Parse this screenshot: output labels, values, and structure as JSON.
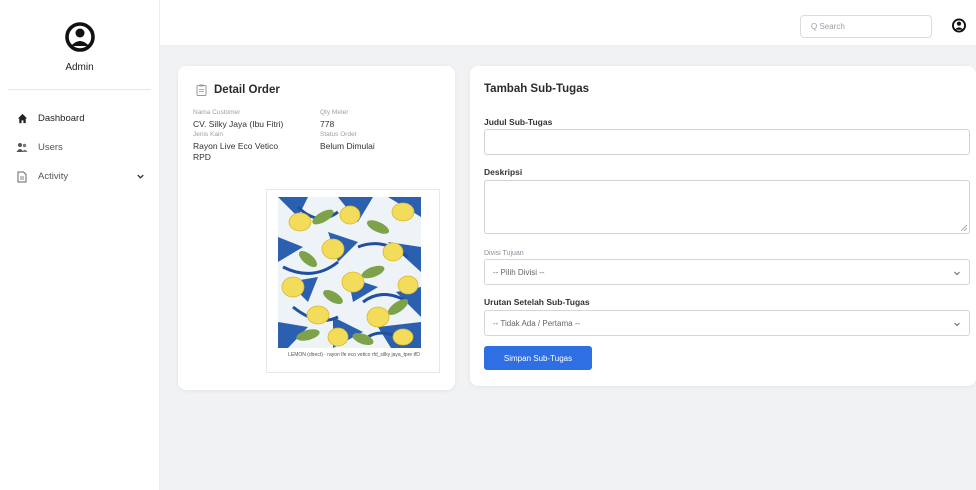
{
  "sidebar": {
    "user_name": "Admin",
    "items": [
      {
        "label": "Dashboard",
        "icon": "home-icon"
      },
      {
        "label": "Users",
        "icon": "users-icon"
      },
      {
        "label": "Activity",
        "icon": "document-icon"
      }
    ]
  },
  "topbar": {
    "search_placeholder": "Q Search"
  },
  "detail": {
    "title": "Detail Order",
    "customer_label": "Nama Customer",
    "customer_value": "CV. Silky Jaya (Ibu Fitri)",
    "kain_label": "Jenis Kain",
    "kain_value": "Rayon Live Eco Vetico",
    "kain_value2": "RPD",
    "qty_label": "Qty Meter",
    "qty_value": "778",
    "status_label": "Status Order",
    "status_value": "Belum Dimulai",
    "image_caption": "LEMON (direct) · rayon lfe eco vetico rfd_silky jaya_tpre tfD"
  },
  "form": {
    "title": "Tambah Sub-Tugas",
    "judul_label": "Judul Sub-Tugas",
    "deskripsi_label": "Deskripsi",
    "divisi_label": "Divisi Tujuan",
    "divisi_value": "-- Pilih Divisi --",
    "urutan_label": "Urutan Setelah Sub-Tugas",
    "urutan_value": "-- Tidak Ada / Pertama --",
    "submit_label": "Simpan Sub-Tugas"
  },
  "colors": {
    "accent": "#2f6fe4",
    "background": "#f1f2f4"
  }
}
